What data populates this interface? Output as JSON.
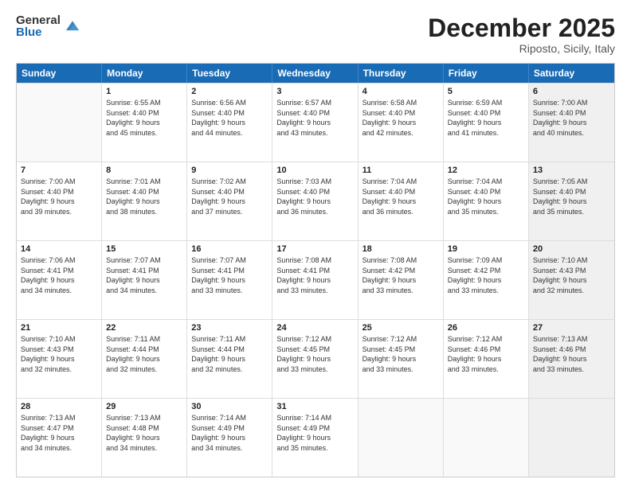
{
  "logo": {
    "general": "General",
    "blue": "Blue"
  },
  "header": {
    "month": "December 2025",
    "location": "Riposto, Sicily, Italy"
  },
  "days": [
    "Sunday",
    "Monday",
    "Tuesday",
    "Wednesday",
    "Thursday",
    "Friday",
    "Saturday"
  ],
  "weeks": [
    [
      {
        "day": "",
        "sunrise": "",
        "sunset": "",
        "daylight": "",
        "empty": true
      },
      {
        "day": "1",
        "sunrise": "Sunrise: 6:55 AM",
        "sunset": "Sunset: 4:40 PM",
        "daylight": "Daylight: 9 hours and 45 minutes."
      },
      {
        "day": "2",
        "sunrise": "Sunrise: 6:56 AM",
        "sunset": "Sunset: 4:40 PM",
        "daylight": "Daylight: 9 hours and 44 minutes."
      },
      {
        "day": "3",
        "sunrise": "Sunrise: 6:57 AM",
        "sunset": "Sunset: 4:40 PM",
        "daylight": "Daylight: 9 hours and 43 minutes."
      },
      {
        "day": "4",
        "sunrise": "Sunrise: 6:58 AM",
        "sunset": "Sunset: 4:40 PM",
        "daylight": "Daylight: 9 hours and 42 minutes."
      },
      {
        "day": "5",
        "sunrise": "Sunrise: 6:59 AM",
        "sunset": "Sunset: 4:40 PM",
        "daylight": "Daylight: 9 hours and 41 minutes."
      },
      {
        "day": "6",
        "sunrise": "Sunrise: 7:00 AM",
        "sunset": "Sunset: 4:40 PM",
        "daylight": "Daylight: 9 hours and 40 minutes.",
        "shaded": true
      }
    ],
    [
      {
        "day": "7",
        "sunrise": "Sunrise: 7:00 AM",
        "sunset": "Sunset: 4:40 PM",
        "daylight": "Daylight: 9 hours and 39 minutes."
      },
      {
        "day": "8",
        "sunrise": "Sunrise: 7:01 AM",
        "sunset": "Sunset: 4:40 PM",
        "daylight": "Daylight: 9 hours and 38 minutes."
      },
      {
        "day": "9",
        "sunrise": "Sunrise: 7:02 AM",
        "sunset": "Sunset: 4:40 PM",
        "daylight": "Daylight: 9 hours and 37 minutes."
      },
      {
        "day": "10",
        "sunrise": "Sunrise: 7:03 AM",
        "sunset": "Sunset: 4:40 PM",
        "daylight": "Daylight: 9 hours and 36 minutes."
      },
      {
        "day": "11",
        "sunrise": "Sunrise: 7:04 AM",
        "sunset": "Sunset: 4:40 PM",
        "daylight": "Daylight: 9 hours and 36 minutes."
      },
      {
        "day": "12",
        "sunrise": "Sunrise: 7:04 AM",
        "sunset": "Sunset: 4:40 PM",
        "daylight": "Daylight: 9 hours and 35 minutes."
      },
      {
        "day": "13",
        "sunrise": "Sunrise: 7:05 AM",
        "sunset": "Sunset: 4:40 PM",
        "daylight": "Daylight: 9 hours and 35 minutes.",
        "shaded": true
      }
    ],
    [
      {
        "day": "14",
        "sunrise": "Sunrise: 7:06 AM",
        "sunset": "Sunset: 4:41 PM",
        "daylight": "Daylight: 9 hours and 34 minutes."
      },
      {
        "day": "15",
        "sunrise": "Sunrise: 7:07 AM",
        "sunset": "Sunset: 4:41 PM",
        "daylight": "Daylight: 9 hours and 34 minutes."
      },
      {
        "day": "16",
        "sunrise": "Sunrise: 7:07 AM",
        "sunset": "Sunset: 4:41 PM",
        "daylight": "Daylight: 9 hours and 33 minutes."
      },
      {
        "day": "17",
        "sunrise": "Sunrise: 7:08 AM",
        "sunset": "Sunset: 4:41 PM",
        "daylight": "Daylight: 9 hours and 33 minutes."
      },
      {
        "day": "18",
        "sunrise": "Sunrise: 7:08 AM",
        "sunset": "Sunset: 4:42 PM",
        "daylight": "Daylight: 9 hours and 33 minutes."
      },
      {
        "day": "19",
        "sunrise": "Sunrise: 7:09 AM",
        "sunset": "Sunset: 4:42 PM",
        "daylight": "Daylight: 9 hours and 33 minutes."
      },
      {
        "day": "20",
        "sunrise": "Sunrise: 7:10 AM",
        "sunset": "Sunset: 4:43 PM",
        "daylight": "Daylight: 9 hours and 32 minutes.",
        "shaded": true
      }
    ],
    [
      {
        "day": "21",
        "sunrise": "Sunrise: 7:10 AM",
        "sunset": "Sunset: 4:43 PM",
        "daylight": "Daylight: 9 hours and 32 minutes."
      },
      {
        "day": "22",
        "sunrise": "Sunrise: 7:11 AM",
        "sunset": "Sunset: 4:44 PM",
        "daylight": "Daylight: 9 hours and 32 minutes."
      },
      {
        "day": "23",
        "sunrise": "Sunrise: 7:11 AM",
        "sunset": "Sunset: 4:44 PM",
        "daylight": "Daylight: 9 hours and 32 minutes."
      },
      {
        "day": "24",
        "sunrise": "Sunrise: 7:12 AM",
        "sunset": "Sunset: 4:45 PM",
        "daylight": "Daylight: 9 hours and 33 minutes."
      },
      {
        "day": "25",
        "sunrise": "Sunrise: 7:12 AM",
        "sunset": "Sunset: 4:45 PM",
        "daylight": "Daylight: 9 hours and 33 minutes."
      },
      {
        "day": "26",
        "sunrise": "Sunrise: 7:12 AM",
        "sunset": "Sunset: 4:46 PM",
        "daylight": "Daylight: 9 hours and 33 minutes."
      },
      {
        "day": "27",
        "sunrise": "Sunrise: 7:13 AM",
        "sunset": "Sunset: 4:46 PM",
        "daylight": "Daylight: 9 hours and 33 minutes.",
        "shaded": true
      }
    ],
    [
      {
        "day": "28",
        "sunrise": "Sunrise: 7:13 AM",
        "sunset": "Sunset: 4:47 PM",
        "daylight": "Daylight: 9 hours and 34 minutes."
      },
      {
        "day": "29",
        "sunrise": "Sunrise: 7:13 AM",
        "sunset": "Sunset: 4:48 PM",
        "daylight": "Daylight: 9 hours and 34 minutes."
      },
      {
        "day": "30",
        "sunrise": "Sunrise: 7:14 AM",
        "sunset": "Sunset: 4:49 PM",
        "daylight": "Daylight: 9 hours and 34 minutes."
      },
      {
        "day": "31",
        "sunrise": "Sunrise: 7:14 AM",
        "sunset": "Sunset: 4:49 PM",
        "daylight": "Daylight: 9 hours and 35 minutes."
      },
      {
        "day": "",
        "sunrise": "",
        "sunset": "",
        "daylight": "",
        "empty": true
      },
      {
        "day": "",
        "sunrise": "",
        "sunset": "",
        "daylight": "",
        "empty": true
      },
      {
        "day": "",
        "sunrise": "",
        "sunset": "",
        "daylight": "",
        "empty": true,
        "shaded": true
      }
    ]
  ]
}
